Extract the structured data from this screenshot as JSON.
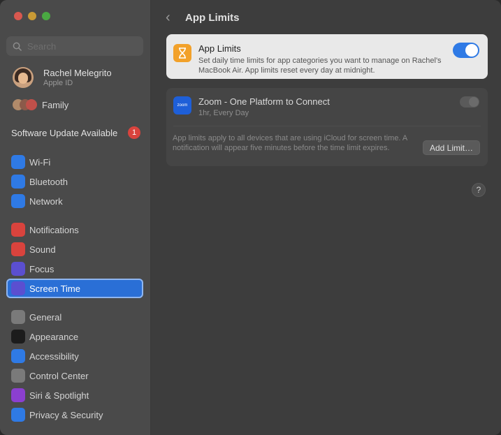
{
  "sidebar": {
    "search_placeholder": "Search",
    "profile": {
      "name": "Rachel Melegrito",
      "subtitle": "Apple ID"
    },
    "family_label": "Family",
    "update": {
      "label": "Software Update Available",
      "count": "1"
    },
    "group1": [
      {
        "label": "Wi-Fi",
        "icon": "wifi-icon",
        "color": "#2f7ae5"
      },
      {
        "label": "Bluetooth",
        "icon": "bluetooth-icon",
        "color": "#2f7ae5"
      },
      {
        "label": "Network",
        "icon": "globe-icon",
        "color": "#2f7ae5"
      }
    ],
    "group2": [
      {
        "label": "Notifications",
        "icon": "bell-icon",
        "color": "#d9433d"
      },
      {
        "label": "Sound",
        "icon": "speaker-icon",
        "color": "#d9433d"
      },
      {
        "label": "Focus",
        "icon": "moon-icon",
        "color": "#5b4fd0"
      },
      {
        "label": "Screen Time",
        "icon": "hourglass-icon",
        "color": "#5b4fd0",
        "active": true
      }
    ],
    "group3": [
      {
        "label": "General",
        "icon": "gear-icon",
        "color": "#7a7a7a"
      },
      {
        "label": "Appearance",
        "icon": "appearance-icon",
        "color": "#1c1c1c"
      },
      {
        "label": "Accessibility",
        "icon": "accessibility-icon",
        "color": "#2f7ae5"
      },
      {
        "label": "Control Center",
        "icon": "control-center-icon",
        "color": "#7a7a7a"
      },
      {
        "label": "Siri & Spotlight",
        "icon": "siri-icon",
        "color": "#8b3fd0"
      },
      {
        "label": "Privacy & Security",
        "icon": "hand-icon",
        "color": "#2f7ae5"
      }
    ]
  },
  "main": {
    "title": "App Limits",
    "app_limits": {
      "title": "App Limits",
      "description": "Set daily time limits for app categories you want to manage on Rachel's MacBook Air. App limits reset every day at midnight.",
      "enabled": true
    },
    "zoom": {
      "icon_label": "zoom",
      "title": "Zoom - One Platform to Connect",
      "subtitle": "1hr, Every Day",
      "enabled": false
    },
    "note": "App limits apply to all devices that are using iCloud for screen time. A notification will appear five minutes before the time limit expires.",
    "add_button": "Add Limit…",
    "help": "?"
  }
}
